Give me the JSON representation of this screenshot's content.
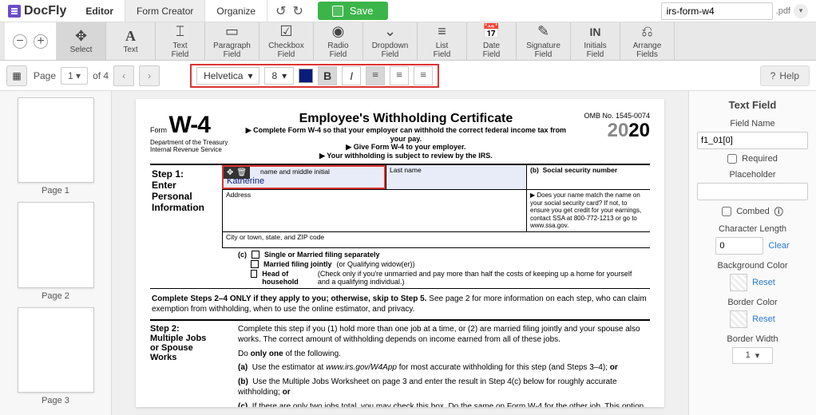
{
  "app": {
    "name": "DocFly"
  },
  "tabs": {
    "editor": "Editor",
    "form": "Form Creator",
    "organize": "Organize"
  },
  "save": "Save",
  "filename": "irs-form-w4",
  "ext": ".pdf",
  "tools": {
    "select": "Select",
    "text": "Text",
    "textfield": "Text\nField",
    "paragraph": "Paragraph\nField",
    "checkbox": "Checkbox\nField",
    "radio": "Radio\nField",
    "dropdown": "Dropdown\nField",
    "list": "List\nField",
    "date": "Date\nField",
    "signature": "Signature\nField",
    "initials": "Initials\nField",
    "arrange": "Arrange\nFields"
  },
  "pagebar": {
    "page": "Page",
    "current": "1",
    "of": "of 4"
  },
  "font": {
    "name": "Helvetica",
    "size": "8"
  },
  "help": "Help",
  "thumbs": [
    "Page 1",
    "Page 2",
    "Page 3"
  ],
  "doc": {
    "form": "Form",
    "w4": "W-4",
    "dept": "Department of the Treasury",
    "irs": "Internal Revenue Service",
    "title": "Employee's Withholding Certificate",
    "s1": "▶ Complete Form W-4 so that your employer can withhold the correct federal income tax from your pay.",
    "s2": "▶ Give Form W-4 to your employer.",
    "s3": "▶ Your withholding is subject to review by the IRS.",
    "omb": "OMB No. 1545-0074",
    "year": "2020",
    "step1": "Step 1:",
    "enter": "Enter",
    "personal": "Personal",
    "info": "Information",
    "fna": "name and middle initial",
    "ln": "Last name",
    "ssnb": "(b)",
    "ssn": "Social security number",
    "input_name": "Katherine",
    "addr": "Address",
    "city": "City or town, state, and ZIP code",
    "match": "▶ Does your name match the name on your social security card? If not, to ensure you get credit for your earnings, contact SSA at 800-772-1213 or go to www.ssa.gov.",
    "c": "(c)",
    "c1": "Single or Married filing separately",
    "c2": "Married filing jointly (or Qualifying widow(er))",
    "c3": "Head of household (Check only if you're unmarried and pay more than half the costs of keeping up a home for yourself and a qualifying individual.)",
    "para1": "Complete Steps 2–4 ONLY if they apply to you; otherwise, skip to Step 5. See page 2 for more information on each step, who can claim exemption from withholding, when to use the online estimator, and privacy.",
    "step2": "Step 2:",
    "mj": "Multiple Jobs",
    "sp": "or Spouse",
    "wk": "Works",
    "p2a": "Complete this step if you (1) hold more than one job at a time, or (2) are married filing jointly and your spouse also works. The correct amount of withholding depends on income earned from all of these jobs.",
    "p2b": "Do only one of the following.",
    "p2c": "(a)  Use the estimator at www.irs.gov/W4App for most accurate withholding for this step (and Steps 3–4); or",
    "p2d": "(b)  Use the Multiple Jobs Worksheet on page 3 and enter the result in Step 4(c) below for roughly accurate withholding; or",
    "p2e": "(c)  If there are only two jobs total, you may check this box. Do the same on Form W-4 for the other job. This option"
  },
  "side": {
    "title": "Text Field",
    "fieldname": "Field Name",
    "fname_val": "f1_01[0]",
    "required": "Required",
    "placeholder": "Placeholder",
    "combed": "Combed",
    "charlen": "Character Length",
    "charlen_val": "0",
    "clear": "Clear",
    "bg": "Background Color",
    "reset": "Reset",
    "bc": "Border Color",
    "bw": "Border Width",
    "bw_val": "1"
  }
}
